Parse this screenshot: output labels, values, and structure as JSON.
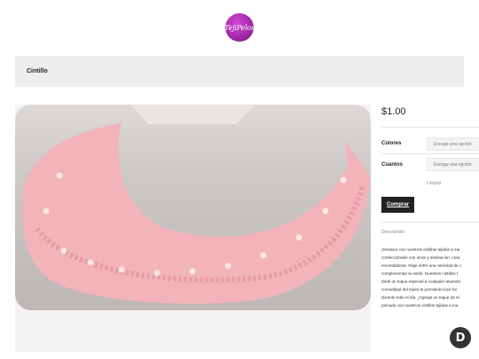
{
  "header": {
    "logo_text": "TejiPelos"
  },
  "breadcrumb": {
    "label": "Cintillo"
  },
  "product": {
    "price": "$1.00",
    "variations": [
      {
        "label": "Colores",
        "select_placeholder": "Escoge una opción"
      },
      {
        "label": "Cuantos",
        "select_placeholder": "Escoge una opción"
      }
    ],
    "clear_label": "Limpiar",
    "buy_label": "Comprar",
    "description_title": "Descripción",
    "description_lines": [
      "¡Destaca con nuestros cintillos tejidos a ma",
      "confeccionado con amor y dedicación, crea",
      "encantadoras. Elige entre una variedad de c",
      "complementar tu estilo. Nuestros cintillos t",
      "darle un toque especial a cualquier atuendo",
      "comodidad del tejido te permitirán lucir he",
      "durante todo el día. ¡Agrega un toque de el",
      "peinado con nuestros cintillos tejidos a ma"
    ]
  },
  "chat": {
    "icon": "chat-d-icon",
    "letter": "D"
  },
  "colors": {
    "accent": "#222222",
    "logo_purple": "#a52aa8",
    "product_pink": "#f3b3bb"
  }
}
